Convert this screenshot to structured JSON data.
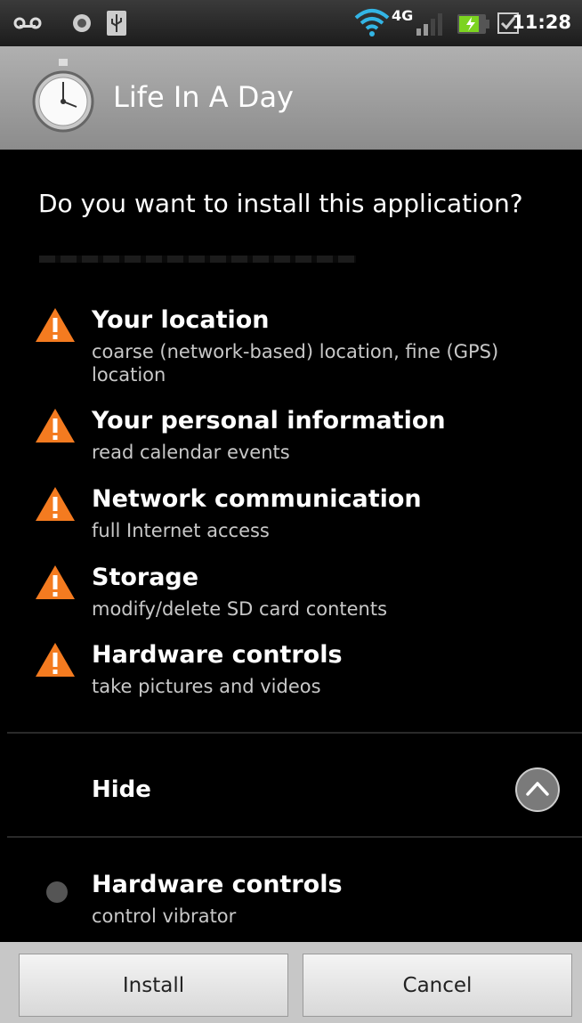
{
  "status_bar": {
    "time": "11:28",
    "network": "4G",
    "icons": [
      "voicemail-icon",
      "app-notification-icon",
      "usb-icon",
      "wifi-icon",
      "4g-icon",
      "signal-icon",
      "battery-charging-icon",
      "checkbox-notification-icon"
    ]
  },
  "app": {
    "title": "Life In A Day",
    "icon": "stopwatch-icon"
  },
  "prompt": {
    "question": "Do you want to install this application?"
  },
  "permissions": [
    {
      "title": "Your location",
      "desc": "coarse (network-based) location, fine (GPS) location",
      "icon": "warning-icon"
    },
    {
      "title": "Your personal information",
      "desc": "read calendar events",
      "icon": "warning-icon"
    },
    {
      "title": "Network communication",
      "desc": "full Internet access",
      "icon": "warning-icon"
    },
    {
      "title": "Storage",
      "desc": "modify/delete SD card contents",
      "icon": "warning-icon"
    },
    {
      "title": "Hardware controls",
      "desc": "take pictures and videos",
      "icon": "warning-icon"
    }
  ],
  "toggle": {
    "label": "Hide",
    "icon": "chevron-up-icon"
  },
  "other_permissions": [
    {
      "title": "Hardware controls",
      "desc": "control vibrator",
      "icon": "bullet-icon"
    }
  ],
  "buttons": {
    "install": "Install",
    "cancel": "Cancel"
  },
  "colors": {
    "warning": "#f47b20",
    "background": "#000000",
    "titlebar": "#9e9e9e"
  }
}
